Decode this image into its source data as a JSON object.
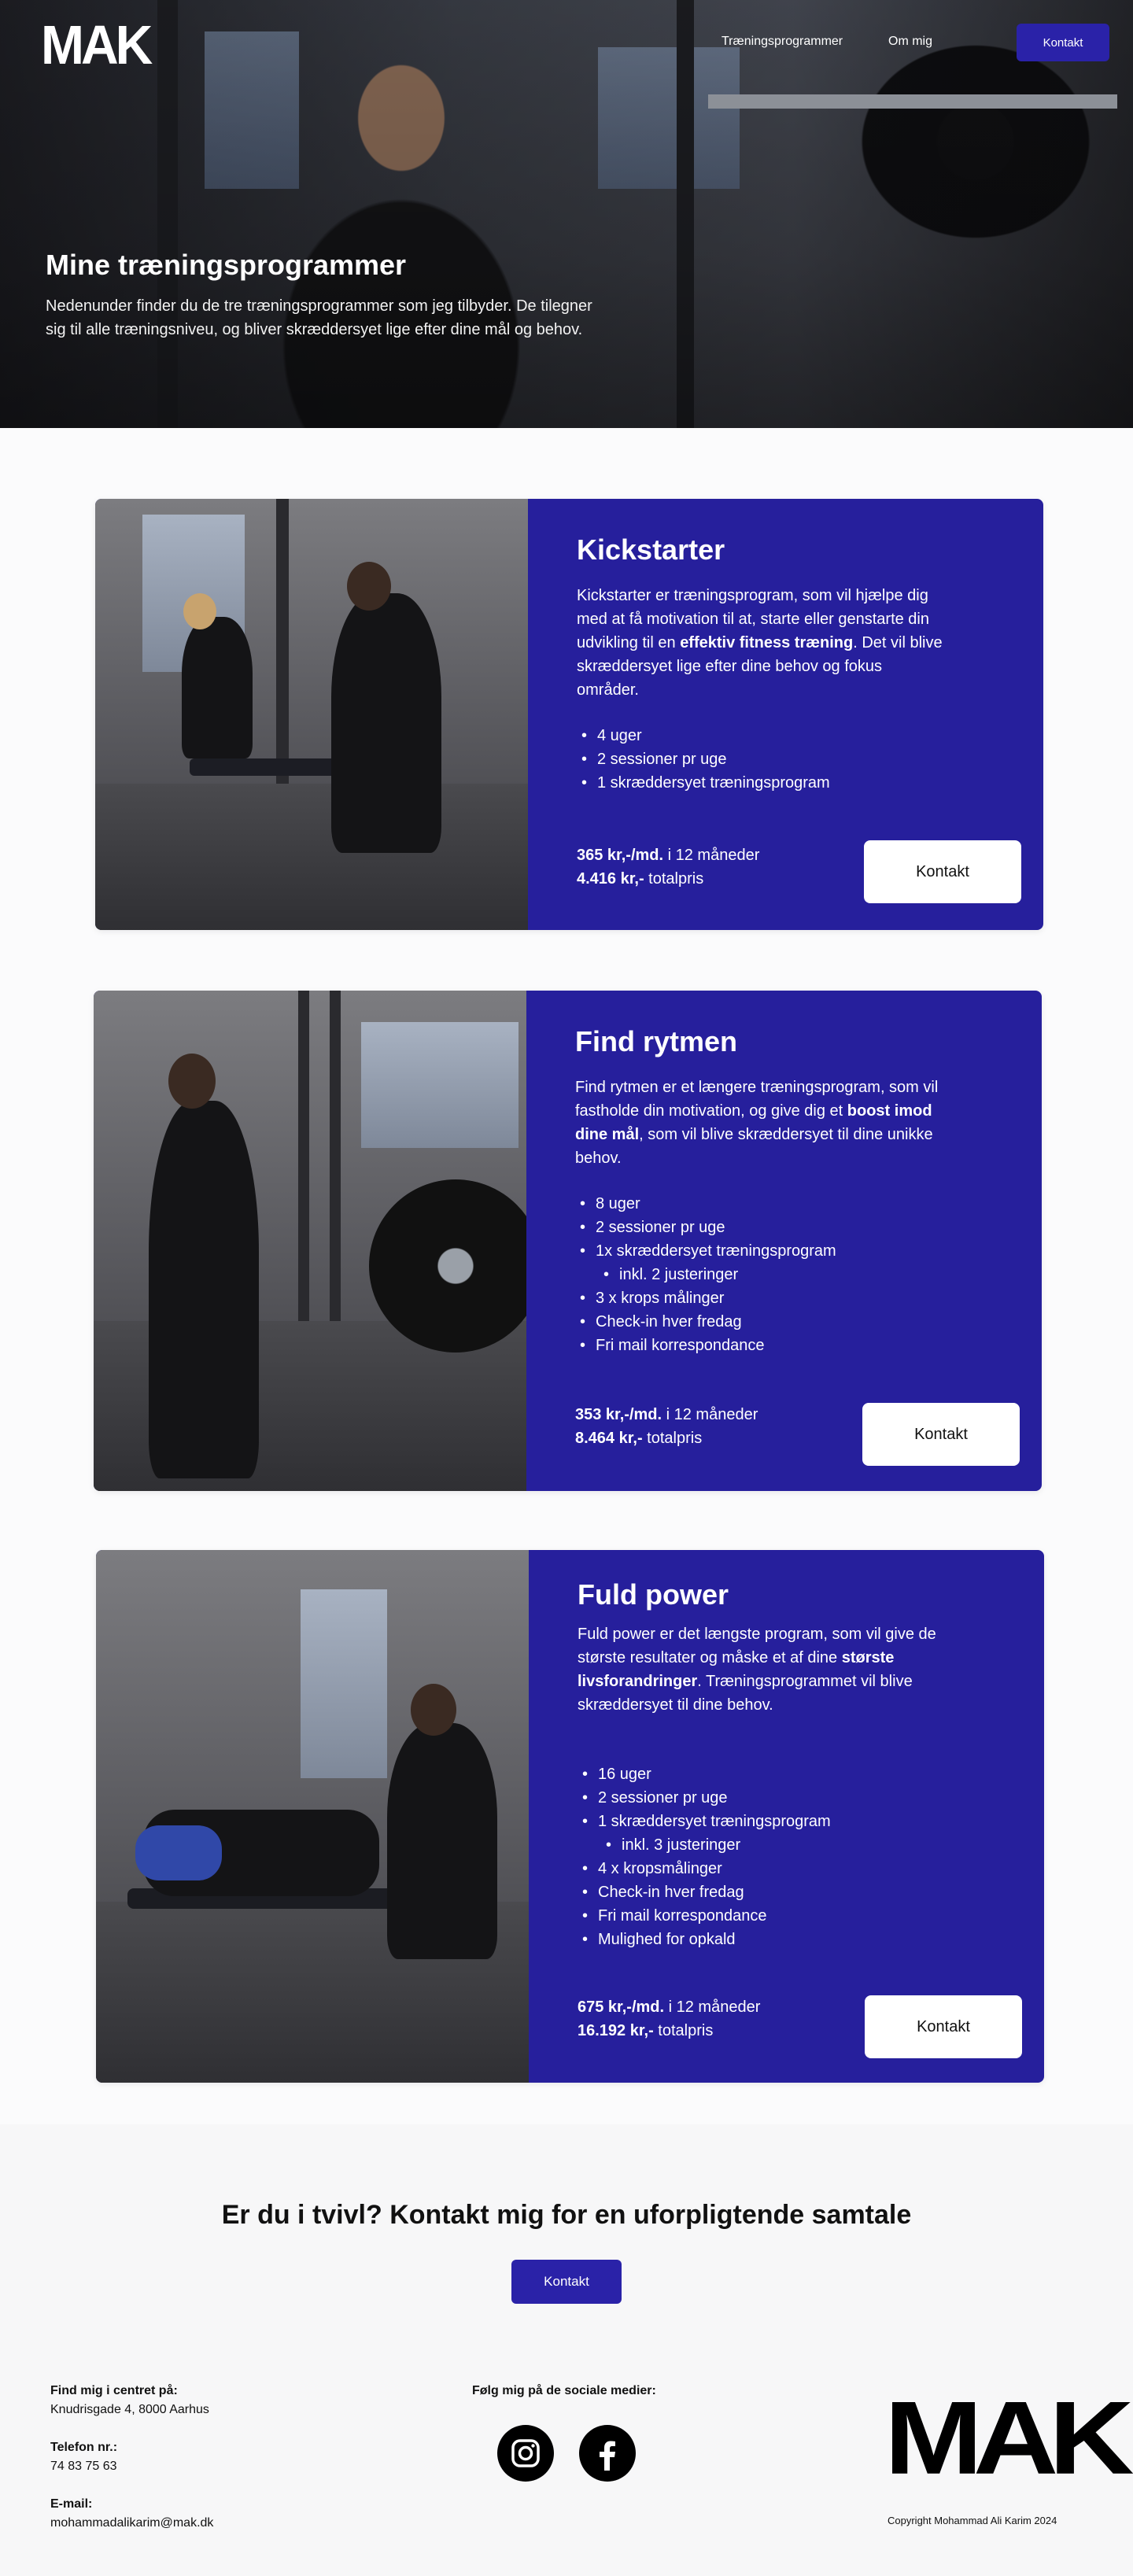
{
  "brand": {
    "logo": "MAK",
    "accent": "#2a22a8"
  },
  "nav": {
    "links": [
      "Træningsprogrammer",
      "Om mig"
    ],
    "cta": "Kontakt"
  },
  "hero": {
    "title": "Mine træningsprogrammer",
    "text": "Nedenunder finder du de tre træningsprogrammer som jeg tilbyder. De tilegner sig til alle træningsniveu, og bliver skræddersyet lige efter dine mål og behov."
  },
  "programs": [
    {
      "title": "Kickstarter",
      "desc_pre": "Kickstarter er træningsprogram, som vil hjælpe dig med at få motivation til at, starte eller genstarte din udvikling til en ",
      "desc_bold": "effektiv fitness træning",
      "desc_post": ". Det vil blive skræddersyet lige efter dine behov og fokus områder.",
      "features": [
        {
          "text": "4 uger",
          "sub": false
        },
        {
          "text": "2 sessioner pr uge",
          "sub": false
        },
        {
          "text": "1 skræddersyet træningsprogram",
          "sub": false
        }
      ],
      "monthly_bold": "365 kr,-/md.",
      "monthly_rest": " i 12 måneder",
      "total_bold": "4.416 kr,-",
      "total_rest": " totalpris",
      "button": "Kontakt"
    },
    {
      "title": "Find rytmen",
      "desc_pre": "Find rytmen er et længere træningsprogram, som vil fastholde din motivation, og give dig et ",
      "desc_bold": "boost imod dine mål",
      "desc_post": ", som vil blive skræddersyet til dine unikke behov.",
      "features": [
        {
          "text": "8 uger",
          "sub": false
        },
        {
          "text": "2 sessioner pr uge",
          "sub": false
        },
        {
          "text": "1x skræddersyet træningsprogram",
          "sub": false
        },
        {
          "text": "inkl. 2 justeringer",
          "sub": true
        },
        {
          "text": "3 x krops målinger",
          "sub": false
        },
        {
          "text": "Check-in hver fredag",
          "sub": false
        },
        {
          "text": "Fri mail korrespondance",
          "sub": false
        }
      ],
      "monthly_bold": "353 kr,-/md.",
      "monthly_rest": " i 12 måneder",
      "total_bold": "8.464 kr,-",
      "total_rest": " totalpris",
      "button": "Kontakt"
    },
    {
      "title": "Fuld power",
      "desc_pre": "Fuld power er det længste program, som vil give de største resultater og måske et af dine ",
      "desc_bold": "største livsforandringer",
      "desc_post": ". Træningsprogrammet vil blive skræddersyet til dine behov.",
      "features": [
        {
          "text": "16 uger",
          "sub": false
        },
        {
          "text": "2 sessioner pr uge",
          "sub": false
        },
        {
          "text": "1 skræddersyet træningsprogram",
          "sub": false
        },
        {
          "text": "inkl. 3 justeringer",
          "sub": true
        },
        {
          "text": "4 x kropsmålinger",
          "sub": false
        },
        {
          "text": "Check-in hver fredag",
          "sub": false
        },
        {
          "text": "Fri mail korrespondance",
          "sub": false
        },
        {
          "text": "Mulighed for opkald",
          "sub": false
        }
      ],
      "monthly_bold": "675 kr,-/md.",
      "monthly_rest": " i 12 måneder",
      "total_bold": "16.192 kr,-",
      "total_rest": " totalpris",
      "button": "Kontakt"
    }
  ],
  "contact_cta": {
    "heading": "Er du i tvivl? Kontakt mig for en uforpligtende samtale",
    "button": "Kontakt"
  },
  "footer": {
    "location_label": "Find mig i centret på:",
    "location_value": "Knudrisgade 4, 8000 Aarhus",
    "phone_label": "Telefon nr.:",
    "phone_value": "74 83 75 63",
    "email_label": "E-mail:",
    "email_value": "mohammadalikarim@mak.dk",
    "social_label": "Følg mig på de sociale medier:",
    "social_icons": [
      "instagram-icon",
      "facebook-icon"
    ],
    "logo": "MAK",
    "copyright": "Copyright Mohammad Ali Karim 2024"
  }
}
